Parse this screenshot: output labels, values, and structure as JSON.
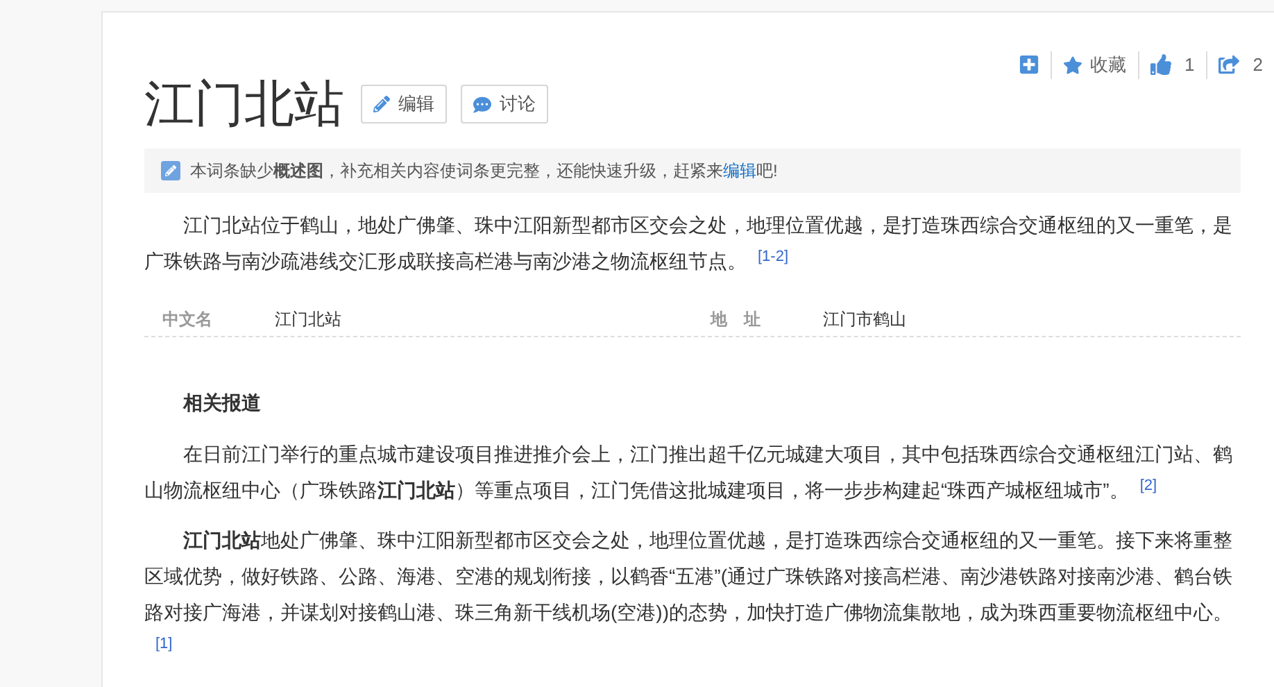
{
  "actions": [
    {
      "kind": "add"
    },
    {
      "kind": "favorite",
      "label": "收藏"
    },
    {
      "kind": "like",
      "count": "1"
    },
    {
      "kind": "share",
      "count": "2"
    }
  ],
  "title": "江门北站",
  "title_buttons": [
    {
      "kind": "edit",
      "label": "编辑"
    },
    {
      "kind": "discuss",
      "label": "讨论"
    }
  ],
  "notice": {
    "text": "本词条缺少**概述图**，补充相关内容使词条更完整，还能快速升级，赶紧来",
    "link": "编辑",
    "tail": "吧!"
  },
  "summary": {
    "text": "江门北站位于鹤山，地处广佛肇、珠中江阳新型都市区交会之处，地理位置优越，是打造珠西综合交通枢纽的又一重笔，是广珠铁路与南沙疏港线交汇形成联接高栏港与南沙港之物流枢纽节点。",
    "ref": "[1-2]"
  },
  "basic_info": [
    {
      "name": "中文名",
      "value": "江门北站"
    },
    {
      "name": "地　址",
      "value": "江门市鹤山"
    }
  ],
  "section_title": "相关报道",
  "paragraphs": [
    {
      "text": "在日前江门举行的重点城市建设项目推进推介会上，江门推出超千亿元城建大项目，其中包括珠西综合交通枢纽江门站、鹤山物流枢纽中心（广珠铁路**江门北站**）等重点项目，江门凭借这批城建项目，将一步步构建起“珠西产城枢纽城市”。",
      "ref": "[2]"
    },
    {
      "text": "**江门北站**地处广佛肇、珠中江阳新型都市区交会之处，地理位置优越，是打造珠西综合交通枢纽的又一重笔。接下来将重整区域优势，做好铁路、公路、海港、空港的规划衔接，以鹤香“五港”(通过广珠铁路对接高栏港、南沙港铁路对接南沙港、鹤台铁路对接广海港，并谋划对接鹤山港、珠三角新干线机场(空港))的态势，加快打造广佛物流集散地，成为珠西重要物流枢纽中心。",
      "ref": "[1]"
    }
  ]
}
